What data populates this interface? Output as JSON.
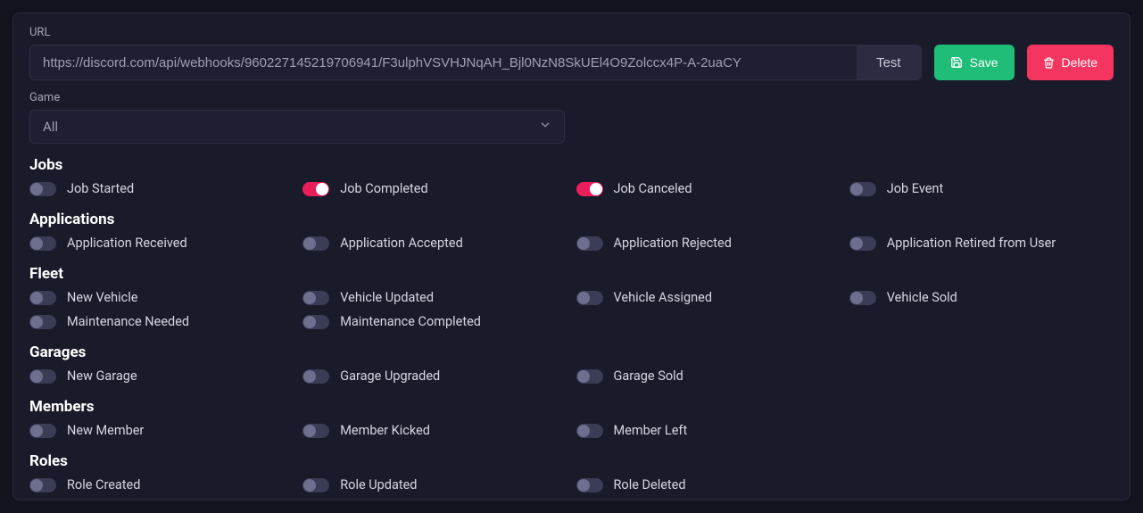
{
  "url": {
    "label": "URL",
    "value": "https://discord.com/api/webhooks/960227145219706941/F3ulphVSVHJNqAH_Bjl0NzN8SkUEl4O9Zolccx4P-A-2uaCY",
    "test_label": "Test"
  },
  "buttons": {
    "save": "Save",
    "delete": "Delete"
  },
  "game": {
    "label": "Game",
    "selected": "All"
  },
  "sections": [
    {
      "title": "Jobs",
      "items": [
        {
          "label": "Job Started",
          "on": false
        },
        {
          "label": "Job Completed",
          "on": true
        },
        {
          "label": "Job Canceled",
          "on": true
        },
        {
          "label": "Job Event",
          "on": false
        }
      ]
    },
    {
      "title": "Applications",
      "items": [
        {
          "label": "Application Received",
          "on": false
        },
        {
          "label": "Application Accepted",
          "on": false
        },
        {
          "label": "Application Rejected",
          "on": false
        },
        {
          "label": "Application Retired from User",
          "on": false
        }
      ]
    },
    {
      "title": "Fleet",
      "items": [
        {
          "label": "New Vehicle",
          "on": false
        },
        {
          "label": "Vehicle Updated",
          "on": false
        },
        {
          "label": "Vehicle Assigned",
          "on": false
        },
        {
          "label": "Vehicle Sold",
          "on": false
        },
        {
          "label": "Maintenance Needed",
          "on": false
        },
        {
          "label": "Maintenance Completed",
          "on": false
        }
      ]
    },
    {
      "title": "Garages",
      "items": [
        {
          "label": "New Garage",
          "on": false
        },
        {
          "label": "Garage Upgraded",
          "on": false
        },
        {
          "label": "Garage Sold",
          "on": false
        }
      ]
    },
    {
      "title": "Members",
      "items": [
        {
          "label": "New Member",
          "on": false
        },
        {
          "label": "Member Kicked",
          "on": false
        },
        {
          "label": "Member Left",
          "on": false
        }
      ]
    },
    {
      "title": "Roles",
      "items": [
        {
          "label": "Role Created",
          "on": false
        },
        {
          "label": "Role Updated",
          "on": false
        },
        {
          "label": "Role Deleted",
          "on": false
        }
      ]
    }
  ]
}
